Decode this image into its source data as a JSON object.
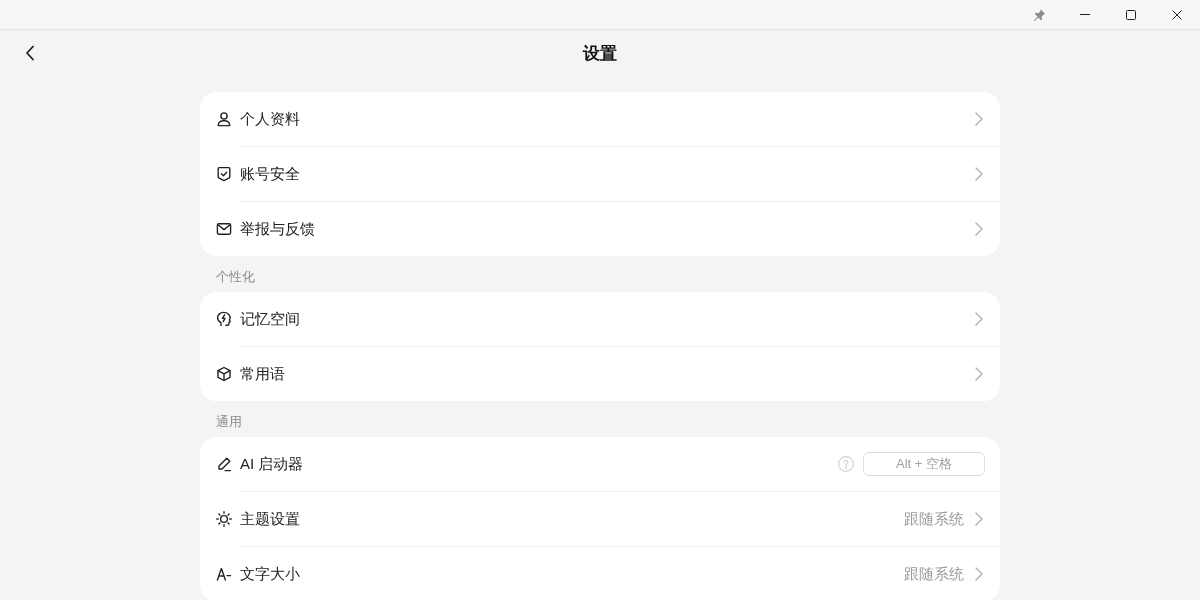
{
  "header": {
    "title": "设置"
  },
  "sections": [
    {
      "items": [
        {
          "kind": "link",
          "label": "个人资料"
        },
        {
          "kind": "link",
          "label": "账号安全"
        },
        {
          "kind": "link",
          "label": "举报与反馈"
        }
      ]
    },
    {
      "title": "个性化",
      "items": [
        {
          "kind": "link",
          "label": "记忆空间"
        },
        {
          "kind": "link",
          "label": "常用语"
        }
      ]
    },
    {
      "title": "通用",
      "items": [
        {
          "kind": "shortcut",
          "label": "AI 启动器",
          "value": "Alt + 空格"
        },
        {
          "kind": "select",
          "label": "主题设置",
          "value": "跟随系统"
        },
        {
          "kind": "select",
          "label": "文字大小",
          "value": "跟随系统"
        }
      ]
    }
  ]
}
